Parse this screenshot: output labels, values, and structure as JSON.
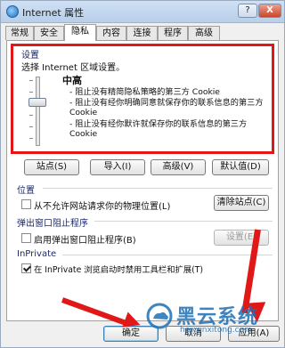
{
  "window": {
    "title": "Internet 属性",
    "help_label": "?",
    "close_label": "X"
  },
  "tabs": [
    {
      "label": "常规"
    },
    {
      "label": "安全"
    },
    {
      "label": "隐私"
    },
    {
      "label": "内容"
    },
    {
      "label": "连接"
    },
    {
      "label": "程序"
    },
    {
      "label": "高级"
    }
  ],
  "settings": {
    "group_label": "设置",
    "instruction": "选择 Internet 区域设置。",
    "level": "中高",
    "bullets": [
      "- 阻止没有精简隐私策略的第三方 Cookie",
      "- 阻止没有经你明确同意就保存你的联系信息的第三方 Cookie",
      "- 阻止没有经你默许就保存你的联系信息的第三方 Cookie"
    ]
  },
  "buttons": {
    "sites": "站点(S)",
    "import": "导入(I)",
    "advanced": "高级(V)",
    "default": "默认值(D)"
  },
  "location": {
    "group_label": "位置",
    "checkbox_label": "从不允许网站请求你的物理位置(L)",
    "clear_sites": "清除站点(C)"
  },
  "popup": {
    "group_label": "弹出窗口阻止程序",
    "checkbox_label": "启用弹出窗口阻止程序(B)",
    "settings_button": "设置(E)"
  },
  "inprivate": {
    "group_label": "InPrivate",
    "checkbox_label": "在 InPrivate 浏览启动时禁用工具栏和扩展(T)"
  },
  "footer": {
    "ok": "确定",
    "cancel": "取消",
    "apply": "应用(A)"
  },
  "watermark": {
    "brand": "黑云系统",
    "url": "heiyunxitong.com"
  }
}
